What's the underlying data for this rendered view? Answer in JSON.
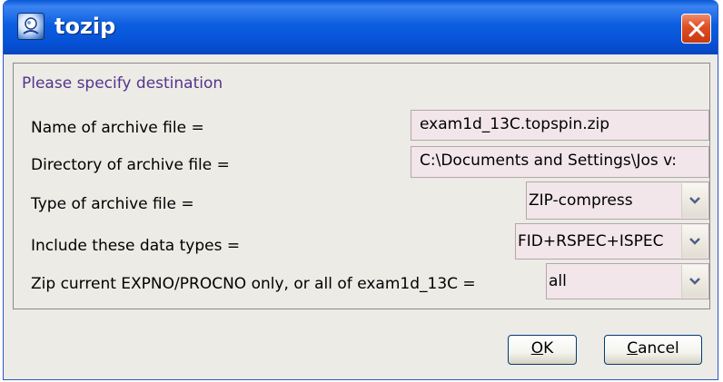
{
  "window": {
    "title": "tozip"
  },
  "content": {
    "destination_label": "Please specify destination",
    "rows": [
      {
        "label": "Name of archive file =",
        "value": "exam1d_13C.topspin.zip"
      },
      {
        "label": "Directory of archive file =",
        "value": "C:\\Documents and Settings\\Jos v:"
      },
      {
        "label": "Type of archive file =",
        "value": "ZIP-compress"
      },
      {
        "label": "Include these data types =",
        "value": "FID+RSPEC+ISPEC"
      },
      {
        "label": "Zip current EXPNO/PROCNO only, or all of exam1d_13C =",
        "value": "all"
      }
    ]
  },
  "buttons": {
    "ok_mnemonic": "O",
    "ok_rest": "K",
    "cancel_mnemonic": "C",
    "cancel_rest": "ancel"
  },
  "colors": {
    "titlebar": "#0a58d6",
    "close_button": "#de4e22",
    "field_background": "#f2e6ea",
    "destination_label": "#55338d",
    "dialog_background": "#ecebe6"
  }
}
